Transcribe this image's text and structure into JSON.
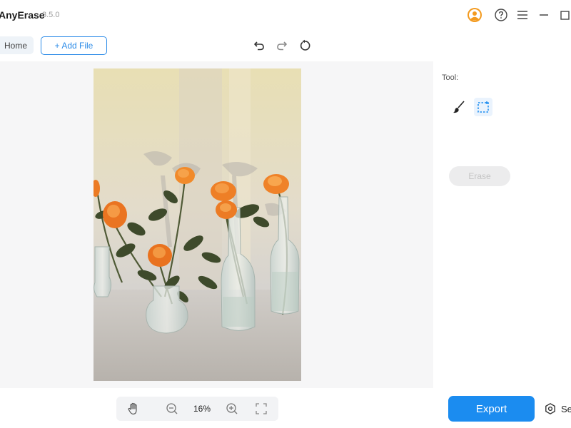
{
  "app": {
    "name": "AnyErase",
    "version": "3.5.0"
  },
  "toolbar": {
    "home_label": "Home",
    "add_file_label": "+ Add File"
  },
  "zoom": {
    "level": "16%"
  },
  "panel": {
    "tool_label": "Tool:",
    "erase_label": "Erase",
    "export_label": "Export",
    "settings_label": "Se"
  },
  "icons": {
    "account": "user-circle-icon",
    "help": "question-circle-icon",
    "menu": "hamburger-menu-icon",
    "minimize": "minimize-icon",
    "maximize": "maximize-icon",
    "undo": "undo-icon",
    "redo": "redo-icon",
    "reset": "reset-icon",
    "hand": "hand-pan-icon",
    "zoom_out": "zoom-out-icon",
    "zoom_in": "zoom-in-icon",
    "fit": "fit-screen-icon",
    "brush": "brush-icon",
    "rect_select": "rectangle-select-icon",
    "settings": "gear-icon"
  },
  "colors": {
    "accent": "#1b8cf0",
    "account_icon": "#f39a1e",
    "canvas_bg": "#f6f6f7"
  }
}
